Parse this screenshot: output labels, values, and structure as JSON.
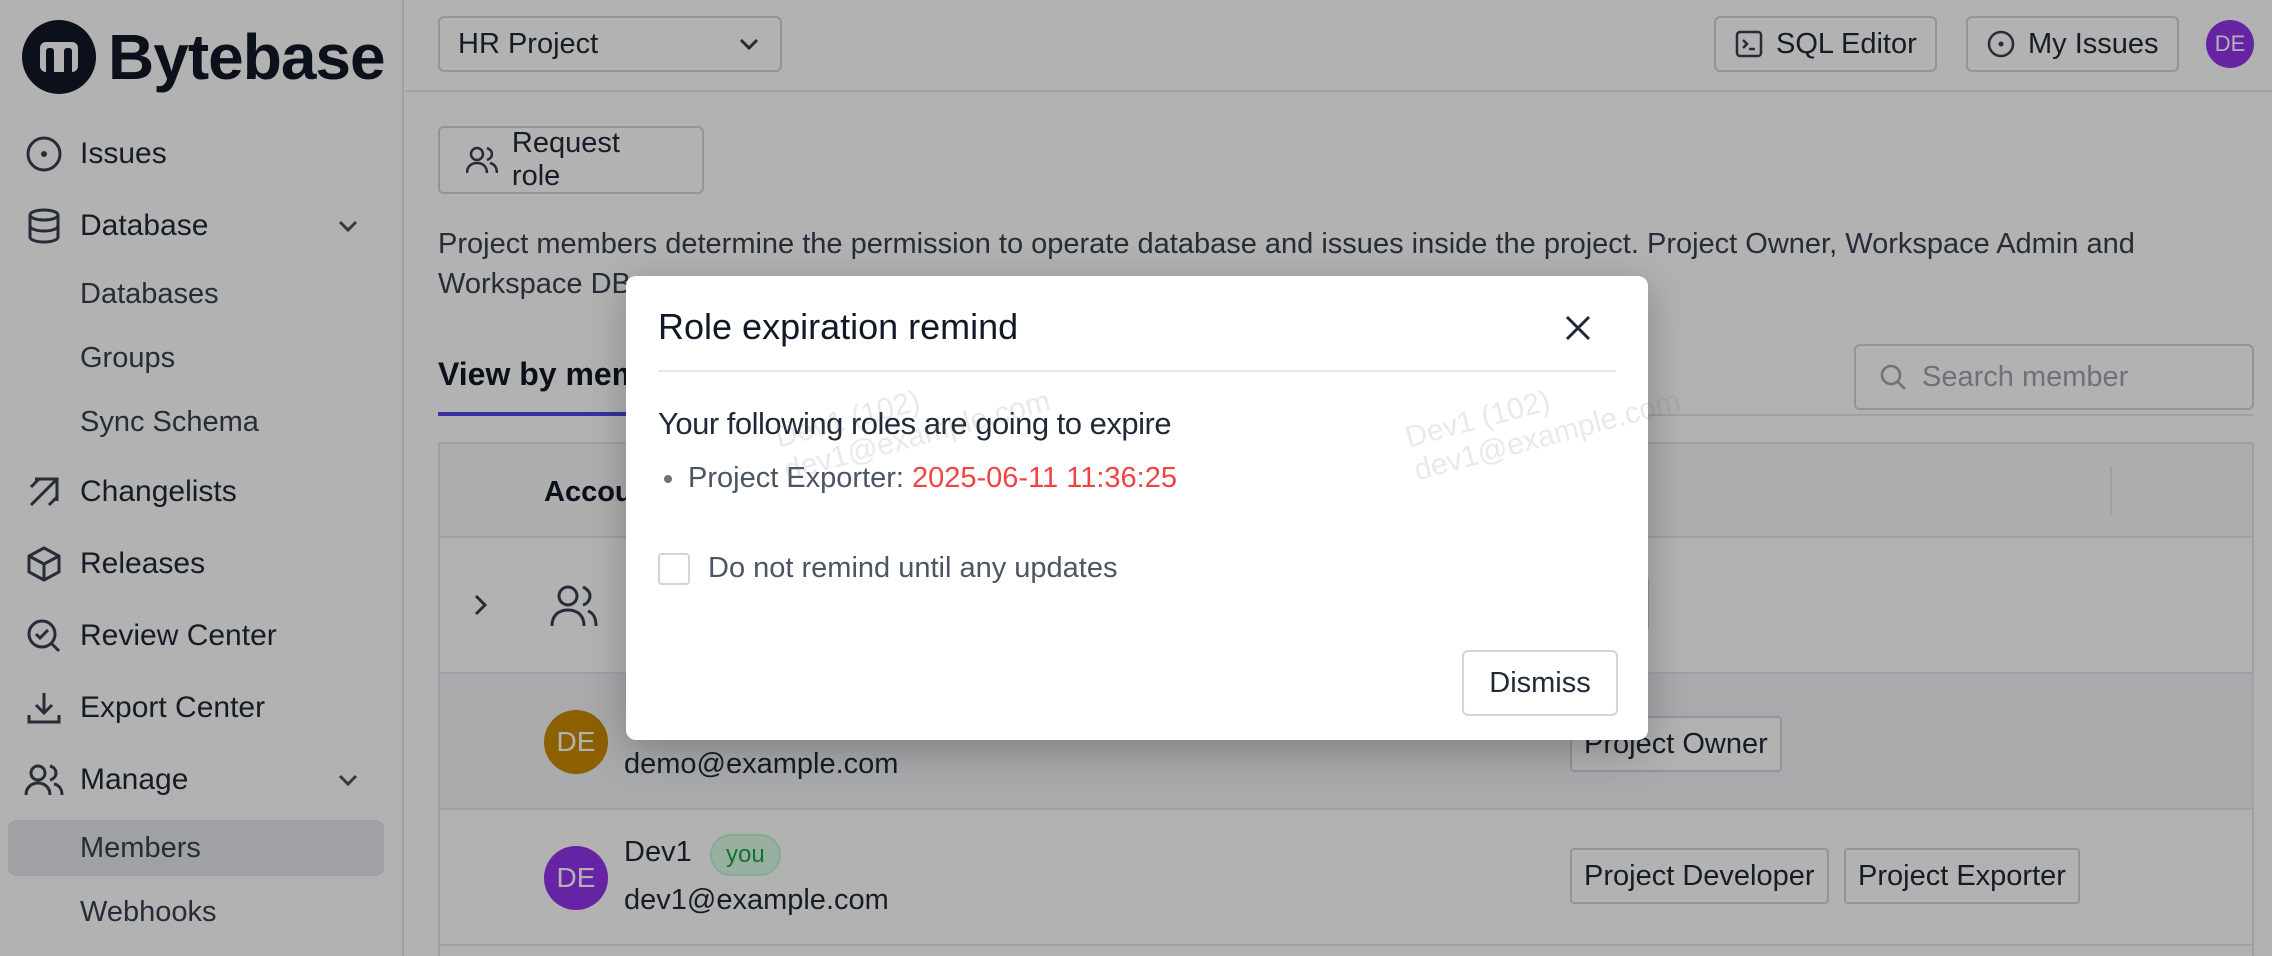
{
  "app": {
    "logo_text": "Bytebase"
  },
  "sidebar": {
    "items": [
      {
        "label": "Issues",
        "icon": "issues-icon"
      },
      {
        "label": "Database",
        "icon": "database-icon"
      },
      {
        "label": "Changelists",
        "icon": "changelists-icon"
      },
      {
        "label": "Releases",
        "icon": "releases-icon"
      },
      {
        "label": "Review Center",
        "icon": "review-center-icon"
      },
      {
        "label": "Export Center",
        "icon": "export-center-icon"
      },
      {
        "label": "Manage",
        "icon": "manage-icon"
      }
    ],
    "database_sub": [
      "Databases",
      "Groups",
      "Sync Schema"
    ],
    "manage_sub": [
      "Members",
      "Webhooks"
    ],
    "active_item": "Members"
  },
  "header": {
    "project": "HR Project",
    "sql_editor": "SQL Editor",
    "my_issues": "My Issues",
    "avatar": "DE"
  },
  "main": {
    "request_role": "Request role",
    "description": "Project members determine the permission to operate database and issues inside the project. Project Owner, Workspace Admin and Workspace DB",
    "tab": "View by mem",
    "search_placeholder": "Search member",
    "table": {
      "account_header": "Accou",
      "group_role_fragment": "A",
      "members": [
        {
          "avatar": "DE",
          "email": "demo@example.com",
          "roles": [
            "Project Owner"
          ],
          "color": "#ca8a04"
        },
        {
          "avatar": "DE",
          "name": "Dev1",
          "badge": "you",
          "email": "dev1@example.com",
          "roles": [
            "Project Developer",
            "Project Exporter"
          ],
          "color": "#9333ea"
        }
      ]
    }
  },
  "watermark": {
    "line1": "Dev1 (102)",
    "line2": "dev1@example.com"
  },
  "modal": {
    "title": "Role expiration remind",
    "subtitle": "Your following roles are going to expire",
    "role_label": "Project Exporter:",
    "role_expiry": "2025-06-11 11:36:25",
    "checkbox_label": "Do not remind until any updates",
    "dismiss": "Dismiss"
  },
  "colors": {
    "accent": "#4f46e5",
    "expiry": "#ef4444",
    "avatar_purple": "#9333ea",
    "avatar_gold": "#ca8a04"
  }
}
